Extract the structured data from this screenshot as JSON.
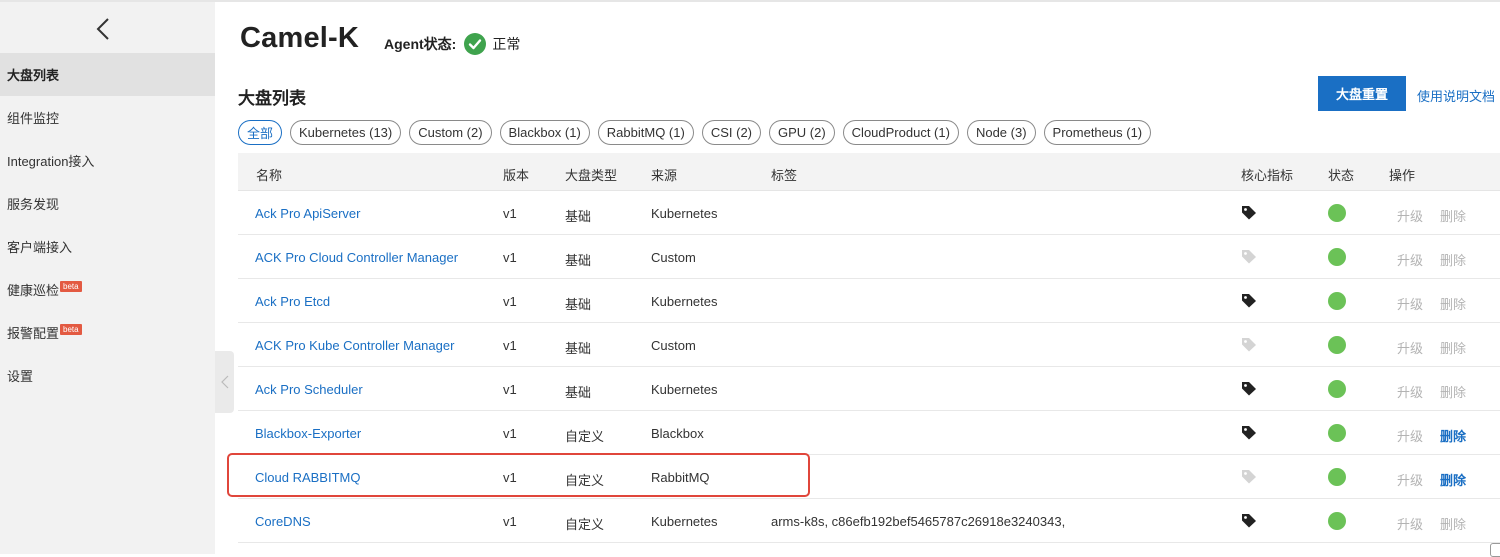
{
  "sidebar": {
    "items": [
      {
        "label": "大盘列表",
        "active": true
      },
      {
        "label": "组件监控"
      },
      {
        "label": "Integration接入"
      },
      {
        "label": "服务发现"
      },
      {
        "label": "客户端接入"
      },
      {
        "label": "健康巡检",
        "badge": "beta"
      },
      {
        "label": "报警配置",
        "badge": "beta"
      },
      {
        "label": "设置"
      }
    ]
  },
  "header": {
    "title": "Camel-K",
    "agent_label": "Agent状态:",
    "agent_state": "正常"
  },
  "section": {
    "title": "大盘列表",
    "reset_button": "大盘重置",
    "doc_link": "使用说明文档"
  },
  "filters": [
    "全部",
    "Kubernetes (13)",
    "Custom (2)",
    "Blackbox (1)",
    "RabbitMQ (1)",
    "CSI (2)",
    "GPU (2)",
    "CloudProduct (1)",
    "Node (3)",
    "Prometheus (1)"
  ],
  "table": {
    "columns": [
      "名称",
      "版本",
      "大盘类型",
      "来源",
      "标签",
      "核心指标",
      "状态",
      "操作"
    ],
    "upgrade_label": "升级",
    "delete_label": "删除",
    "rows": [
      {
        "name": "Ack Pro ApiServer",
        "version": "v1",
        "type": "基础",
        "source": "Kubernetes",
        "tags": "",
        "core_metric": true,
        "deletable": false
      },
      {
        "name": "ACK Pro Cloud Controller Manager",
        "version": "v1",
        "type": "基础",
        "source": "Custom",
        "tags": "",
        "core_metric": false,
        "deletable": false
      },
      {
        "name": "Ack Pro Etcd",
        "version": "v1",
        "type": "基础",
        "source": "Kubernetes",
        "tags": "",
        "core_metric": true,
        "deletable": false
      },
      {
        "name": "ACK Pro Kube Controller Manager",
        "version": "v1",
        "type": "基础",
        "source": "Custom",
        "tags": "",
        "core_metric": false,
        "deletable": false
      },
      {
        "name": "Ack Pro Scheduler",
        "version": "v1",
        "type": "基础",
        "source": "Kubernetes",
        "tags": "",
        "core_metric": true,
        "deletable": false
      },
      {
        "name": "Blackbox-Exporter",
        "version": "v1",
        "type": "自定义",
        "source": "Blackbox",
        "tags": "",
        "core_metric": true,
        "deletable": true
      },
      {
        "name": "Cloud RABBITMQ",
        "version": "v1",
        "type": "自定义",
        "source": "RabbitMQ",
        "tags": "",
        "core_metric": false,
        "deletable": true
      },
      {
        "name": "CoreDNS",
        "version": "v1",
        "type": "自定义",
        "source": "Kubernetes",
        "tags": "arms-k8s, c86efb192bef5465787c26918e3240343,",
        "core_metric": true,
        "deletable": false
      }
    ]
  },
  "colors": {
    "accent": "#1a6fc4",
    "status_ok": "#6bc257",
    "highlight": "#e0463b",
    "beta": "#e35a42"
  }
}
